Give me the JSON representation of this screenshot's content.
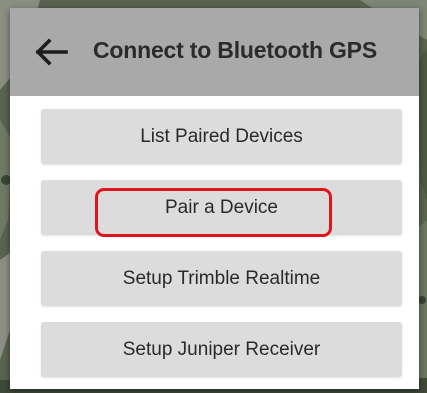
{
  "dialog": {
    "title": "Connect to Bluetooth GPS",
    "back_icon": "arrow-left-icon",
    "header_color": "#a9a9a9"
  },
  "menu": {
    "items": [
      {
        "label": "List Paired Devices"
      },
      {
        "label": "Pair a Device",
        "highlighted": true
      },
      {
        "label": "Setup Trimble Realtime"
      },
      {
        "label": "Setup Juniper Receiver"
      }
    ],
    "button_color": "#dcdcdc"
  },
  "annotation": {
    "highlight_color": "#e0151b"
  },
  "background": {
    "type": "satellite-map"
  }
}
